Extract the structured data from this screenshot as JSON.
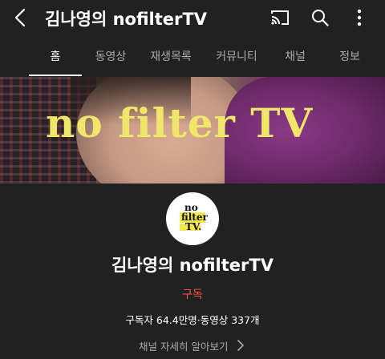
{
  "header": {
    "title": "김나영의 nofilterTV",
    "back_icon": "chevron-left-icon",
    "cast_icon": "cast-icon",
    "search_icon": "search-icon",
    "more_icon": "more-vertical-icon"
  },
  "tabs": [
    {
      "label": "홈",
      "active": true
    },
    {
      "label": "동영상",
      "active": false
    },
    {
      "label": "재생목록",
      "active": false
    },
    {
      "label": "커뮤니티",
      "active": false
    },
    {
      "label": "채널",
      "active": false
    },
    {
      "label": "정보",
      "active": false
    }
  ],
  "banner": {
    "text": "no filter TV"
  },
  "avatar": {
    "logo_lines": [
      "no",
      "filter",
      "TV."
    ]
  },
  "channel": {
    "name": "김나영의 nofilterTV",
    "subscribe_label": "구독",
    "stats": "구독자 64.4만명·동영상 337개",
    "more_label": "채널 자세히 알아보기"
  },
  "colors": {
    "background": "#212121",
    "subscribe": "#ff4e45",
    "banner_text": "#efe66a",
    "muted_text": "#aaaaaa"
  }
}
